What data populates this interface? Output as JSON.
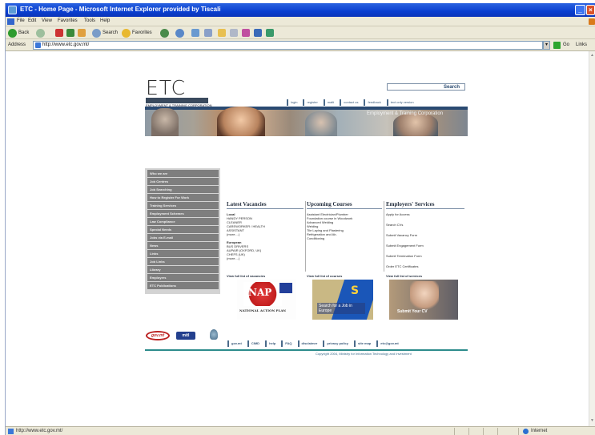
{
  "window": {
    "title": "ETC - Home Page - Microsoft Internet Explorer provided by Tiscali"
  },
  "menu": [
    "File",
    "Edit",
    "View",
    "Favorites",
    "Tools",
    "Help"
  ],
  "toolbar": {
    "back": "Back",
    "search": "Search",
    "favorites": "Favorites"
  },
  "address": {
    "label": "Address",
    "url": "http://www.etc.gov.mt/",
    "go": "Go",
    "links": "Links"
  },
  "status": {
    "url": "http://www.etc.gov.mt/",
    "zone": "Internet"
  },
  "site": {
    "logo": "ETC",
    "logo_sub": "EMPLOYMENT & TRAINING CORPORATION",
    "search_label": "Search",
    "top_links": [
      "login",
      "register",
      "malti",
      "contact us",
      "feedback",
      "text only version"
    ],
    "banner_title": "Employment & Training Corporation",
    "nav": [
      "Who we are",
      "Job Centres",
      "Job Searching",
      "How to Register For Work",
      "Training Services",
      "Employment Schemes",
      "Law Compliance",
      "Special Needs",
      "Jobs via E-mail",
      "News",
      "Links",
      "Job Links",
      "Library",
      "Employers",
      "ETC Publications"
    ],
    "vacancies": {
      "title": "Latest Vacancies",
      "local_heading": "Local",
      "local": [
        "HANDY PERSON",
        "CLEANER",
        "CAREWORKER / HEALTH",
        "ASSISTANT",
        "(more....)"
      ],
      "european_heading": "European",
      "european": [
        "BUS DRIVERS",
        "AUPAIR (OXFORD, UK)",
        "CHEFS (UK)",
        "(more....)"
      ],
      "view_all": "View full list of vacancies"
    },
    "courses": {
      "title": "Upcoming Courses",
      "items": [
        "Assistant Electrician/Plumber",
        "Foundation course in Woodwork",
        "Advanced Welding",
        "Welding",
        "Tile Laying and Plastering",
        "Refrigeration and Air-",
        "Conditioning"
      ],
      "view_all": "View full list of courses"
    },
    "services": {
      "title": "Employers' Services",
      "items": [
        "Apply for Access",
        "Search CVs",
        "Submit Vacancy Form",
        "Submit Engagement Form",
        "Submit Termination Form",
        "Order ETC Certificates"
      ],
      "view_all": "View full list of services"
    },
    "promos": {
      "nap": "NAP",
      "nap_caption": "NATIONAL ACTION PLAN",
      "jobs": "Search for a Job in Europe",
      "cv": "Submit Your CV"
    },
    "footer_logos": {
      "gov": "gov.mt",
      "mitl": "mitl"
    },
    "footer_links": [
      "gov.mt",
      "CIMD",
      "help",
      "FAQ",
      "disclaimer",
      "privacy policy",
      "site map",
      "etc@gov.mt"
    ],
    "copyright": "Copyright 2004, Ministry for Information Technology and Investment"
  }
}
